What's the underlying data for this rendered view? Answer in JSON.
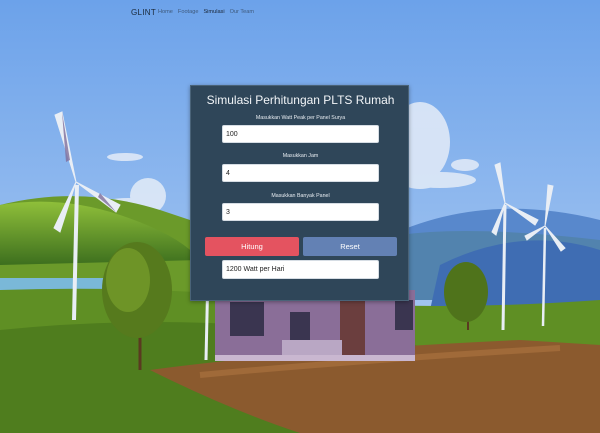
{
  "navbar": {
    "brand": "GLINT",
    "links": [
      "Home",
      "Footage",
      "Simulasi",
      "Our Team"
    ],
    "active_link": "Simulasi"
  },
  "calculator": {
    "title": "Simulasi Perhitungan PLTS Rumah",
    "fields": [
      {
        "label": "Masukkan Watt Peak per Panel Surya",
        "value": "100"
      },
      {
        "label": "Masukkan Jam",
        "value": "4"
      },
      {
        "label": "Masukkan Banyak Panel",
        "value": "3"
      }
    ],
    "hitung_label": "Hitung",
    "reset_label": "Reset",
    "result": "1200 Watt per Hari"
  },
  "colors": {
    "sky": "#6fa6e8",
    "card_bg": "#2f4659",
    "hitung_button": "#e45360",
    "reset_button": "#6381b4",
    "grass": "#5c8a22"
  }
}
